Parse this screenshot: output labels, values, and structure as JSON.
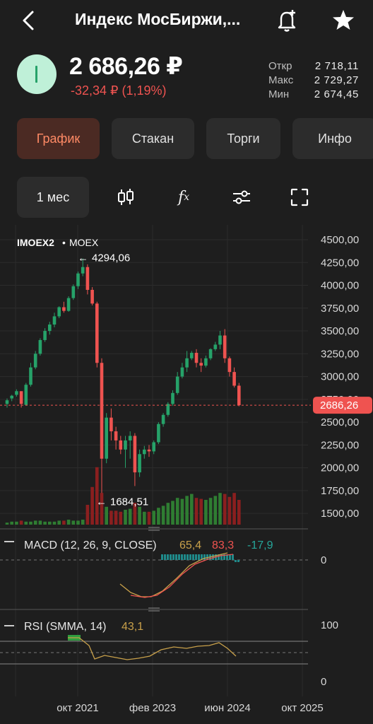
{
  "header": {
    "title": "Индекс МосБиржи,..."
  },
  "instrument": {
    "price": "2 686,26 ₽",
    "change": "-32,34 ₽ (1,19%)",
    "stats": [
      {
        "label": "Откр",
        "value": "2 718,11"
      },
      {
        "label": "Макс",
        "value": "2 729,27"
      },
      {
        "label": "Мин",
        "value": "2 674,45"
      }
    ]
  },
  "tabs": [
    "График",
    "Стакан",
    "Торги",
    "Инфо"
  ],
  "toolbar": {
    "period_label": "1 мес",
    "fx_label": "f",
    "fx_sub": "x"
  },
  "colors": {
    "up": "#26a269",
    "down": "#ef5350",
    "accent": "#ff8a65",
    "bg": "#1e1e1e"
  },
  "chart_data": {
    "type": "candlestick",
    "ticker": "IMOEX2",
    "exchange": "MOEX",
    "y_ticks": [
      "4500,00",
      "4250,00",
      "4000,00",
      "3750,00",
      "3500,00",
      "3250,00",
      "3000,00",
      "2750,00",
      "2500,00",
      "2250,00",
      "2000,00",
      "1750,00",
      "1500,00"
    ],
    "ylim": [
      1350,
      4600
    ],
    "x_ticks": [
      "окт 2021",
      "фев 2023",
      "июн 2024",
      "окт 2025"
    ],
    "current_price_label": "2686,26",
    "current_price": 2686.26,
    "max_label": "4294,06",
    "max_value": 4294.06,
    "min_label": "1684,51",
    "min_value": 1684.51,
    "candles": [
      [
        2700,
        2760,
        2660,
        2740
      ],
      [
        2760,
        2800,
        2730,
        2790
      ],
      [
        2800,
        2860,
        2780,
        2840
      ],
      [
        2840,
        2810,
        2660,
        2700
      ],
      [
        2690,
        2930,
        2680,
        2910
      ],
      [
        2910,
        3150,
        2890,
        3100
      ],
      [
        3100,
        3280,
        3080,
        3250
      ],
      [
        3250,
        3420,
        3230,
        3400
      ],
      [
        3400,
        3530,
        3380,
        3500
      ],
      [
        3500,
        3600,
        3460,
        3570
      ],
      [
        3570,
        3700,
        3540,
        3660
      ],
      [
        3660,
        3770,
        3640,
        3760
      ],
      [
        3760,
        3820,
        3700,
        3720
      ],
      [
        3720,
        3880,
        3710,
        3860
      ],
      [
        3860,
        4010,
        3840,
        3990
      ],
      [
        3990,
        4150,
        3960,
        4130
      ],
      [
        4130,
        4294,
        4100,
        4200
      ],
      [
        4200,
        4230,
        3900,
        3950
      ],
      [
        3950,
        3980,
        3780,
        3800
      ],
      [
        3800,
        3820,
        3100,
        3150
      ],
      [
        3150,
        3200,
        1684,
        2100
      ],
      [
        2100,
        2600,
        2050,
        2550
      ],
      [
        2550,
        2650,
        2300,
        2400
      ],
      [
        2400,
        2450,
        2200,
        2300
      ],
      [
        2300,
        2350,
        2150,
        2200
      ],
      [
        2200,
        2350,
        2000,
        2300
      ],
      [
        2300,
        2400,
        2100,
        2350
      ],
      [
        2350,
        2380,
        1800,
        1950
      ],
      [
        1950,
        2200,
        1900,
        2150
      ],
      [
        2150,
        2240,
        2100,
        2200
      ],
      [
        2200,
        2250,
        2120,
        2180
      ],
      [
        2180,
        2300,
        2150,
        2280
      ],
      [
        2280,
        2500,
        2260,
        2480
      ],
      [
        2480,
        2600,
        2450,
        2580
      ],
      [
        2580,
        2720,
        2560,
        2700
      ],
      [
        2700,
        2850,
        2680,
        2820
      ],
      [
        2820,
        3050,
        2800,
        3000
      ],
      [
        3000,
        3150,
        2980,
        3100
      ],
      [
        3100,
        3280,
        3050,
        3200
      ],
      [
        3200,
        3280,
        3180,
        3260
      ],
      [
        3260,
        3300,
        3100,
        3150
      ],
      [
        3150,
        3200,
        3050,
        3120
      ],
      [
        3120,
        3230,
        3100,
        3200
      ],
      [
        3200,
        3310,
        3180,
        3300
      ],
      [
        3300,
        3380,
        3280,
        3350
      ],
      [
        3350,
        3500,
        3300,
        3450
      ],
      [
        3450,
        3520,
        3150,
        3200
      ],
      [
        3200,
        3220,
        3000,
        3050
      ],
      [
        3050,
        3100,
        2880,
        2900
      ],
      [
        2900,
        2930,
        2674,
        2686
      ]
    ],
    "volumes": [
      2,
      3,
      3,
      4,
      3,
      3,
      4,
      4,
      3,
      3,
      3,
      4,
      4,
      5,
      4,
      4,
      5,
      20,
      38,
      58,
      32,
      18,
      14,
      14,
      13,
      15,
      16,
      22,
      18,
      13,
      13,
      14,
      17,
      19,
      22,
      24,
      27,
      26,
      29,
      31,
      27,
      26,
      25,
      27,
      29,
      32,
      31,
      28,
      32,
      25
    ],
    "macd": {
      "label": "MACD (12, 26, 9, CLOSE)",
      "macd_val": "65,4",
      "signal_val": "83,3",
      "hist_val": "-17,9",
      "zero_label": "0"
    },
    "rsi": {
      "label": "RSI (SMMA, 14)",
      "value": "43,1",
      "top_label": "100",
      "bottom_label": "0"
    }
  }
}
